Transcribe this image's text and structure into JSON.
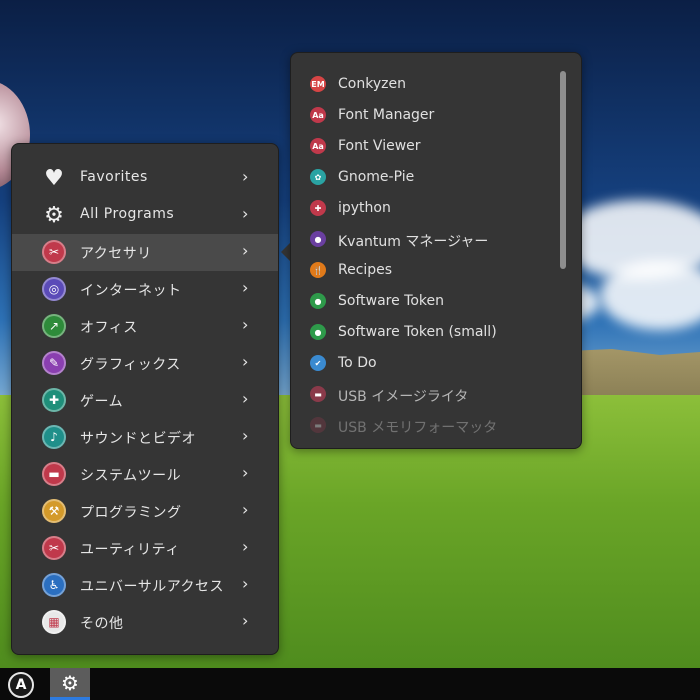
{
  "menu": {
    "items": [
      {
        "label": "Favorites",
        "icon": "heart-icon",
        "color": "transparent",
        "glyph": "♥"
      },
      {
        "label": "All Programs",
        "icon": "gear-icon",
        "color": "transparent",
        "glyph": "⚙"
      },
      {
        "label": "アクセサリ",
        "icon": "accessories-icon",
        "color": "#c0394b",
        "glyph": "✂"
      },
      {
        "label": "インターネット",
        "icon": "internet-icon",
        "color": "#5b4bb8",
        "glyph": "◎"
      },
      {
        "label": "オフィス",
        "icon": "office-icon",
        "color": "#2e8b3a",
        "glyph": "↗"
      },
      {
        "label": "グラフィックス",
        "icon": "graphics-icon",
        "color": "#8a3fb0",
        "glyph": "✎"
      },
      {
        "label": "ゲーム",
        "icon": "games-icon",
        "color": "#1f8f7a",
        "glyph": "✚"
      },
      {
        "label": "サウンドとビデオ",
        "icon": "multimedia-icon",
        "color": "#1f8f8a",
        "glyph": "♪"
      },
      {
        "label": "システムツール",
        "icon": "system-tools-icon",
        "color": "#c0394b",
        "glyph": "▬"
      },
      {
        "label": "プログラミング",
        "icon": "programming-icon",
        "color": "#d49a2a",
        "glyph": "⚒"
      },
      {
        "label": "ユーティリティ",
        "icon": "utilities-icon",
        "color": "#c0394b",
        "glyph": "✂"
      },
      {
        "label": "ユニバーサルアクセス",
        "icon": "accessibility-icon",
        "color": "#2b6fc0",
        "glyph": "♿"
      },
      {
        "label": "その他",
        "icon": "other-icon",
        "color": "#e8e8e8",
        "glyph": "▦"
      }
    ],
    "chevron": "›",
    "active_index": 2
  },
  "submenu": {
    "items": [
      {
        "label": "Conkyzen",
        "icon": "conkyzen-icon",
        "color": "#d64545",
        "glyph": "EM"
      },
      {
        "label": "Font Manager",
        "icon": "font-manager-icon",
        "color": "#c0394b",
        "glyph": "Aa"
      },
      {
        "label": "Font Viewer",
        "icon": "font-viewer-icon",
        "color": "#c0394b",
        "glyph": "Aa"
      },
      {
        "label": "Gnome-Pie",
        "icon": "gnome-pie-icon",
        "color": "#2aa3a3",
        "glyph": "✿"
      },
      {
        "label": "ipython",
        "icon": "ipython-icon",
        "color": "#c0394b",
        "glyph": "✚"
      },
      {
        "label": "Kvantum マネージャー",
        "icon": "kvantum-icon",
        "color": "#6a3fa0",
        "glyph": "●"
      },
      {
        "label": "Recipes",
        "icon": "recipes-icon",
        "color": "#e07a1a",
        "glyph": "🍴"
      },
      {
        "label": "Software Token",
        "icon": "software-token-icon",
        "color": "#2e9a4a",
        "glyph": "●"
      },
      {
        "label": "Software Token (small)",
        "icon": "software-token-small-icon",
        "color": "#2e9a4a",
        "glyph": "●"
      },
      {
        "label": "To Do",
        "icon": "todo-icon",
        "color": "#3a8ad0",
        "glyph": "✔"
      },
      {
        "label": "USB イメージライタ",
        "icon": "usb-image-writer-icon",
        "color": "#8a3a4a",
        "glyph": "▬"
      },
      {
        "label": "USB メモリフォーマッタ",
        "icon": "usb-formatter-icon",
        "color": "#8a3a4a",
        "glyph": "▬"
      }
    ]
  },
  "taskbar": {
    "launcher_glyph": "A",
    "settings_glyph": "⚙"
  }
}
